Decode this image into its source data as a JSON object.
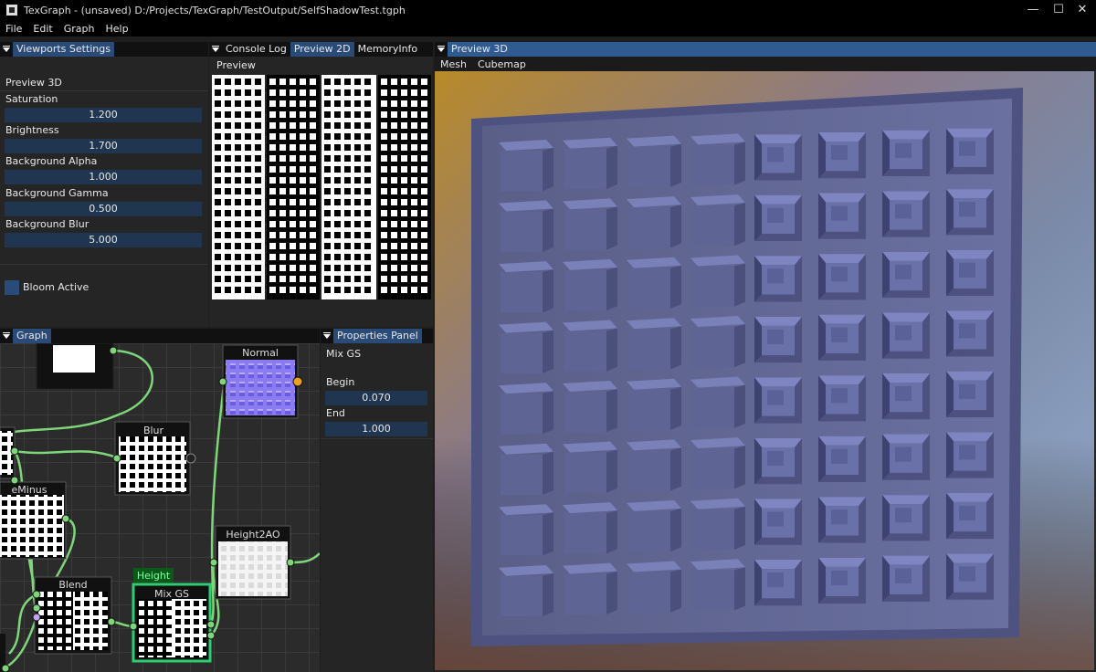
{
  "window": {
    "title": "TexGraph - (unsaved) D:/Projects/TexGraph/TestOutput/SelfShadowTest.tgph",
    "minimize": "—",
    "maximize": "☐",
    "close": "✕"
  },
  "menu": [
    "File",
    "Edit",
    "Graph",
    "Help"
  ],
  "viewports_settings": {
    "tab": "Viewports Settings",
    "section": "Preview 3D",
    "fields": [
      {
        "label": "Saturation",
        "value": "1.200"
      },
      {
        "label": "Brightness",
        "value": "1.700"
      },
      {
        "label": "Background Alpha",
        "value": "1.000"
      },
      {
        "label": "Background Gamma",
        "value": "0.500"
      },
      {
        "label": "Background Blur",
        "value": "5.000"
      }
    ],
    "bloom_label": "Bloom Active"
  },
  "center_tabs": {
    "tabs": [
      "Console Log",
      "Preview 2D",
      "MemoryInfo"
    ],
    "active": "Preview 2D",
    "preview_menu": "Preview"
  },
  "graph": {
    "tab": "Graph",
    "nodes": {
      "normal": "Normal",
      "blur": "Blur",
      "minus": "eMinus",
      "height2ao": "Height2AO",
      "blend": "Blend",
      "mixgs": "Mix GS",
      "height_tag": "Height"
    }
  },
  "properties": {
    "tab": "Properties Panel",
    "node_name": "Mix GS",
    "fields": [
      {
        "label": "Begin",
        "value": "0.070"
      },
      {
        "label": "End",
        "value": "1.000"
      }
    ]
  },
  "preview3d": {
    "tab": "Preview 3D",
    "menu": [
      "Mesh",
      "Cubemap"
    ]
  },
  "colors": {
    "accent_tab": "#2a4a78",
    "field_bg": "#1f3550",
    "wire": "#7fd67a",
    "node_selected": "#2ecc71",
    "normal_map": "#8a7cf0"
  }
}
